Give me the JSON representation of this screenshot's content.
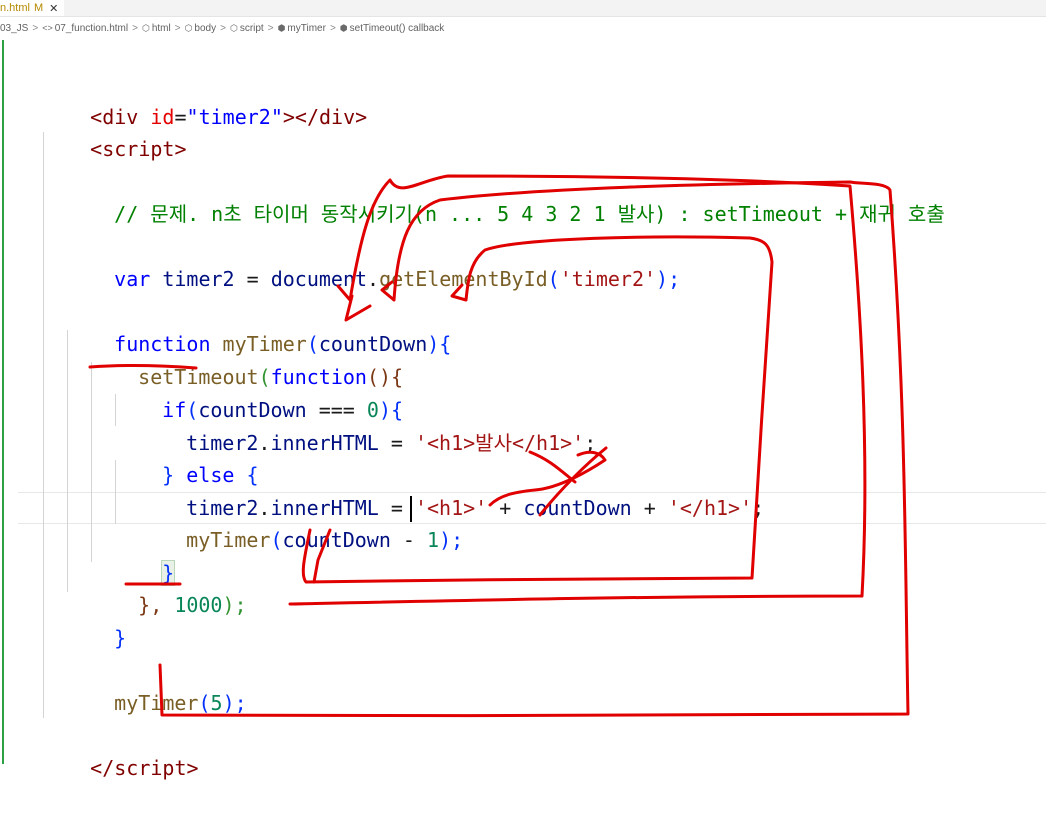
{
  "tab": {
    "filename": "n.html",
    "modified_marker": "M",
    "close_glyph": "✕"
  },
  "breadcrumb": {
    "items": [
      "03_JS",
      "07_function.html",
      "html",
      "body",
      "script",
      "myTimer",
      "setTimeout() callback"
    ],
    "separator": ">"
  },
  "editor": {
    "accent_color": "#2ea043",
    "lines": [
      [
        "<",
        "div",
        " ",
        "id",
        "=",
        "\"timer2\"",
        "></",
        "div",
        ">"
      ],
      [
        "<",
        "script",
        ">"
      ],
      [
        "// 문제. n초 타이머 동작시키기(n ... 5 4 3 2 1 발사) : setTimeout + 재귀 호출"
      ],
      [
        "var",
        " ",
        "timer2",
        " = ",
        "document",
        ".",
        "getElementById",
        "(",
        "'timer2'",
        ");"
      ],
      [
        "function",
        " ",
        "myTimer",
        "(",
        "countDown",
        "){"
      ],
      [
        "setTimeout",
        "(",
        "function",
        "(){"
      ],
      [
        "if",
        "(",
        "countDown",
        " === ",
        "0",
        "){"
      ],
      [
        "timer2",
        ".",
        "innerHTML",
        " = ",
        "'<h1>발사</h1>'",
        ";"
      ],
      [
        "}",
        " ",
        "else",
        " ",
        "{"
      ],
      [
        "timer2",
        ".",
        "innerHTML",
        " = ",
        "'<h1>'",
        " + ",
        "countDown",
        " + ",
        "'</h1>'",
        ";"
      ],
      [
        "myTimer",
        "(",
        "countDown",
        " - ",
        "1",
        ");"
      ],
      [
        "}"
      ],
      [
        "},",
        " ",
        "1000",
        ");"
      ],
      [
        "}"
      ],
      [
        "myTimer",
        "(",
        "5",
        ");"
      ],
      [
        "</",
        "script",
        ">"
      ]
    ]
  }
}
